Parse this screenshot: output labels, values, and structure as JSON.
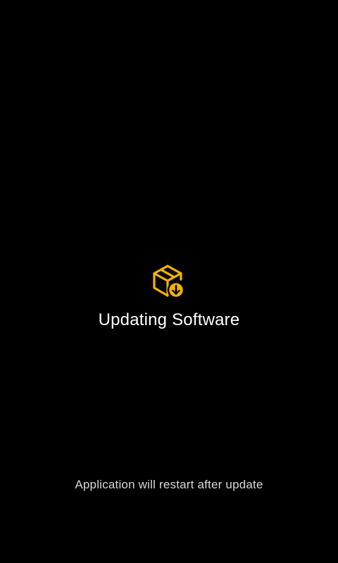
{
  "screen": {
    "title": "Updating Software",
    "footer_message": "Application will restart after update",
    "icon": "package-download-icon"
  },
  "colors": {
    "background": "#000000",
    "accent": "#F5B301",
    "title_text": "#FFFFFF",
    "footer_text": "#D8D8D8"
  }
}
